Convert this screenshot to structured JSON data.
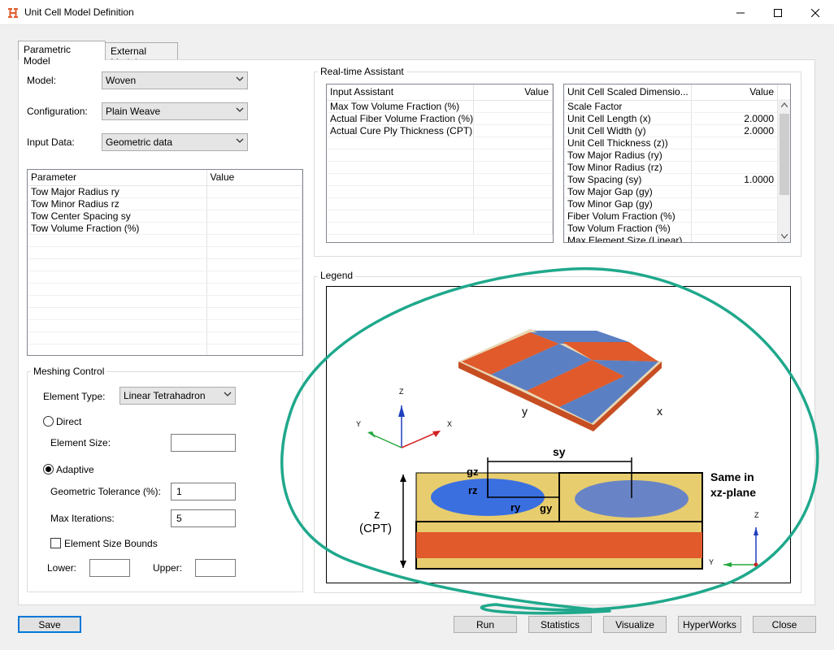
{
  "window": {
    "title": "Unit Cell Model Definition",
    "minimize_icon": "minimize-icon",
    "maximize_icon": "maximize-icon",
    "close_icon": "close-icon"
  },
  "tabs": [
    {
      "label": "Parametric Model",
      "active": true
    },
    {
      "label": "External Model",
      "active": false
    }
  ],
  "form": {
    "model_label": "Model:",
    "model_value": "Woven",
    "configuration_label": "Configuration:",
    "configuration_value": "Plain Weave",
    "input_data_label": "Input Data:",
    "input_data_value": "Geometric data"
  },
  "parameter_table": {
    "columns": [
      "Parameter",
      "Value"
    ],
    "rows": [
      [
        "Tow Major Radius ry",
        ""
      ],
      [
        "Tow Minor Radius rz",
        ""
      ],
      [
        "Tow Center Spacing sy",
        ""
      ],
      [
        "Tow Volume Fraction (%)",
        ""
      ]
    ]
  },
  "meshing": {
    "title": "Meshing Control",
    "element_type_label": "Element Type:",
    "element_type_value": "Linear Tetrahadron",
    "direct_label": "Direct",
    "element_size_label": "Element Size:",
    "element_size_value": "",
    "adaptive_label": "Adaptive",
    "geometric_tolerance_label": "Geometric Tolerance (%):",
    "geometric_tolerance_value": "1",
    "max_iterations_label": "Max Iterations:",
    "max_iterations_value": "5",
    "element_size_bounds_label": "Element Size Bounds",
    "lower_label": "Lower:",
    "lower_value": "",
    "upper_label": "Upper:",
    "upper_value": "",
    "selected_mode": "Adaptive"
  },
  "assistant": {
    "title": "Real-time Assistant",
    "input_table": {
      "columns": [
        "Input Assistant",
        "Value"
      ],
      "rows": [
        [
          "Max Tow Volume Fraction (%)",
          ""
        ],
        [
          "Actual Fiber Volume Fraction (%)",
          ""
        ],
        [
          "Actual Cure Ply Thickness (CPT)",
          ""
        ]
      ]
    },
    "scaled_table": {
      "columns": [
        "Unit Cell Scaled Dimensio...",
        "Value"
      ],
      "rows": [
        [
          "Scale Factor",
          ""
        ],
        [
          "Unit Cell Length (x)",
          "2.0000"
        ],
        [
          "Unit Cell Width (y)",
          "2.0000"
        ],
        [
          "Unit Cell Thickness (z))",
          ""
        ],
        [
          "Tow Major Radius (ry)",
          ""
        ],
        [
          "Tow Minor Radius (rz)",
          ""
        ],
        [
          "Tow Spacing (sy)",
          "1.0000"
        ],
        [
          "Tow Major Gap (gy)",
          ""
        ],
        [
          "Tow Minor Gap (gy)",
          ""
        ],
        [
          "Fiber Volum Fraction (%)",
          ""
        ],
        [
          "Tow Volum Fraction (%)",
          ""
        ],
        [
          "Max Element Size (Linear)",
          ""
        ]
      ]
    }
  },
  "legend": {
    "title": "Legend",
    "axis_y": "y",
    "axis_x": "x",
    "triad_z": "Z",
    "triad_y": "Y",
    "triad_x": "X",
    "sy": "sy",
    "gz": "gz",
    "rz": "rz",
    "ry": "ry",
    "gy": "gy",
    "z_label": "z",
    "cpt_label": "(CPT)",
    "same_line1": "Same in",
    "same_line2": "xz-plane",
    "colors": {
      "orange": "#e05a2b",
      "blue": "#5b7fc3",
      "tan": "#e8cd6e",
      "annotation": "#1fa88c"
    }
  },
  "buttons": {
    "save": "Save",
    "run": "Run",
    "statistics": "Statistics",
    "visualize": "Visualize",
    "hyperworks": "HyperWorks",
    "close": "Close"
  }
}
